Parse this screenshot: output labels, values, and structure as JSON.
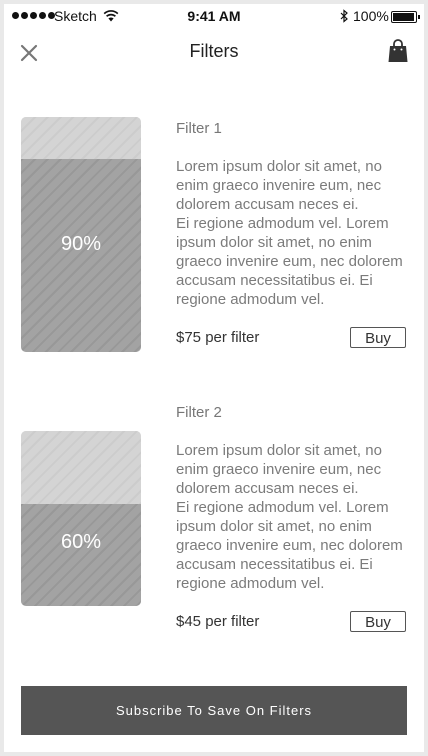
{
  "status_bar": {
    "carrier": "Sketch",
    "time": "9:41 AM",
    "battery": "100%"
  },
  "nav": {
    "title": "Filters",
    "close_icon": "close-icon",
    "cart_icon": "shopping-bag-icon"
  },
  "filters": [
    {
      "name": "Filter 1",
      "description": [
        "Lorem ipsum dolor sit amet, no enim graeco invenire eum, nec dolorem accusam neces ei.",
        "Ei regione admodum vel. Lorem ipsum dolor sit amet, no enim graeco invenire eum, nec dolorem accusam necessitatibus ei. Ei regione admodum vel."
      ],
      "level_label": "90%",
      "level": 0.9,
      "price": "$75 per filter",
      "buy_label": "Buy"
    },
    {
      "name": "Filter 2",
      "description": [
        "Lorem ipsum dolor sit amet, no enim graeco invenire eum, nec dolorem accusam neces ei.",
        "Ei regione admodum vel. Lorem ipsum dolor sit amet, no enim graeco invenire eum, nec dolorem accusam necessitatibus ei. Ei regione admodum vel."
      ],
      "level_label": "60%",
      "level": 0.6,
      "price": "$45 per filter",
      "buy_label": "Buy"
    }
  ],
  "subscribe_label": "Subscribe To Save On Filters",
  "colors": {
    "fill": "#a3a3a3",
    "empty": "#d6d6d6",
    "button_dark": "#555555"
  }
}
